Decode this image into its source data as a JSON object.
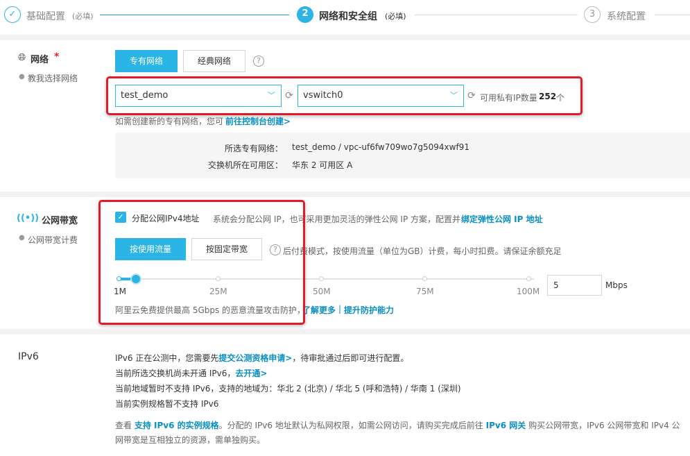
{
  "stepper": {
    "step1_label": "基础配置",
    "step1_required": "(必填)",
    "step2_number": "2",
    "step2_label": "网络和安全组",
    "step2_required": "(必填)",
    "step3_number": "3",
    "step3_label": "系统配置"
  },
  "network": {
    "title": "网络",
    "required_mark": "*",
    "help_link": "教我选择网络",
    "tab_vpc": "专有网络",
    "tab_classic": "经典网络",
    "help_icon": "?",
    "vpc_value": "test_demo",
    "vswitch_value": "vswitch0",
    "available_ip_prefix": "可用私有IP数量",
    "available_ip_count": "252",
    "available_ip_suffix": "个",
    "create_hint": "如需创建新的专有网络，您可",
    "create_link": "前往控制台创建>",
    "selected_vpc_label": "所选专有网络：",
    "selected_vpc_value": "test_demo / vpc-uf6fw709wo7g5094xwf91",
    "zone_label": "交换机所在可用区：",
    "zone_value": "华东 2 可用区 A"
  },
  "bandwidth": {
    "title": "公网带宽",
    "sub_label": "公网带宽计费",
    "checkbox_label": "分配公网IPv4地址",
    "checkbox_desc": "系统会分配公网 IP，也可采用更加灵活的弹性公网 IP 方案，配置并",
    "checkbox_link": "绑定弹性公网 IP 地址",
    "tab_traffic": "按使用流量",
    "tab_fixed": "按固定带宽",
    "billing_desc": "后付费模式，按使用流量（单位为GB）计费，每小时扣费。请保证余额充足",
    "slider_value": 1,
    "slider_max": 100,
    "ticks": [
      "1M",
      "25M",
      "50M",
      "75M",
      "100M"
    ],
    "input_value": "5",
    "unit": "Mbps",
    "protect_text": "阿里云免费提供最高 5Gbps 的恶意流量攻击防护，",
    "learn_more": "了解更多",
    "divider": "|",
    "improve_link": "提升防护能力"
  },
  "ipv6": {
    "title": "IPv6",
    "line1_prefix": "IPv6 正在公测中，您需要先",
    "line1_link": "提交公测资格申请>",
    "line1_suffix": "，待审批通过后即可进行配置。",
    "line2_prefix": "当前所选交换机尚未开通 IPv6，",
    "line2_link": "去开通>",
    "line3": "当前地域暂时不支持 IPv6，支持的地域为：华北 2 (北京) / 华北 5 (呼和浩特) / 华南 1 (深圳)",
    "line4": "当前实例规格暂不支持 IPv6",
    "note_prefix": "查看",
    "note_link1": "支持 IPv6 的实例规格",
    "note_mid": "。分配的 IPv6 地址默认为私网权限，如需公网访问，请购买完成后前往",
    "note_link2": "IPv6 网关",
    "note_suffix": "购买公网带宽，IPv6 公网带宽和 IPv4 公",
    "note_line2": "网带宽是互相独立的资源，需单独购买。"
  },
  "colors": {
    "accent": "#2ab5e6",
    "link": "#0a8fc4",
    "highlight_box": "#e21b2a"
  }
}
